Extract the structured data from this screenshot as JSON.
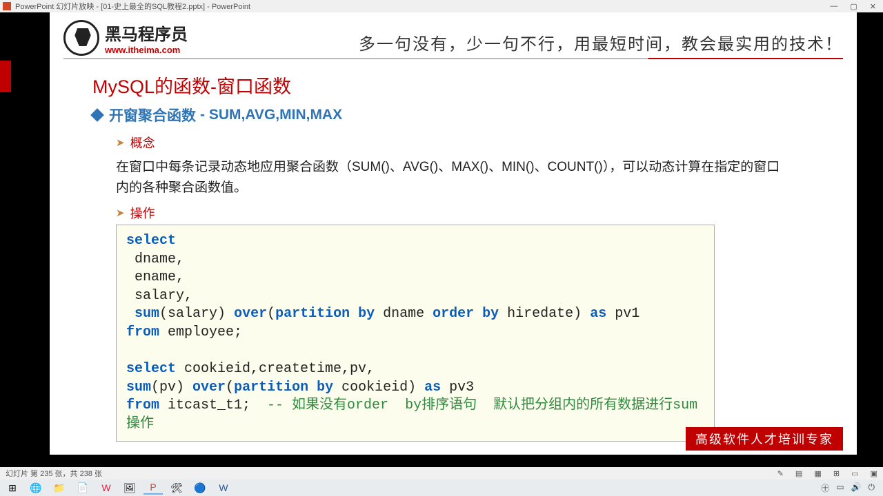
{
  "window": {
    "title": "PowerPoint 幻灯片放映 - [01-史上最全的SQL教程2.pptx] - PowerPoint",
    "min": "—",
    "restore": "▢",
    "close": "✕"
  },
  "logo": {
    "cn": "黑马程序员",
    "en": "www.itheima.com"
  },
  "slogan": "多一句没有，少一句不行，用最短时间，教会最实用的技术！",
  "slide_title": "MySQL的函数-窗口函数",
  "section": {
    "heading_main": "开窗聚合函数",
    "heading_suffix": "- SUM,AVG,MIN,MAX"
  },
  "sub": {
    "concept": "概念",
    "operation": "操作"
  },
  "body_text": "在窗口中每条记录动态地应用聚合函数（SUM()、AVG()、MAX()、MIN()、COUNT()），可以动态计算在指定的窗口内的各种聚合函数值。",
  "code": {
    "line1_kw": "select",
    "line2": " dname,",
    "line3": " ename,",
    "line4": " salary,",
    "line5_pre": " ",
    "line5_sum": "sum",
    "line5_mid1": "(salary) ",
    "line5_over": "over",
    "line5_mid2": "(",
    "line5_part": "partition by",
    "line5_mid3": " dname ",
    "line5_order": "order by",
    "line5_mid4": " hiredate) ",
    "line5_as": "as",
    "line5_end": " pv1",
    "line6_from": "from",
    "line6_end": " employee;",
    "line8_select": "select",
    "line8_end": " cookieid,createtime,pv,",
    "line9_sum": "sum",
    "line9_mid1": "(pv) ",
    "line9_over": "over",
    "line9_mid2": "(",
    "line9_part": "partition by",
    "line9_mid3": " cookieid) ",
    "line9_as": "as",
    "line9_end": " pv3",
    "line10_from": "from",
    "line10_mid": " itcast_t1;  ",
    "line10_comment": "-- 如果没有order  by排序语句  默认把分组内的所有数据进行sum操作"
  },
  "footer_badge": "高级软件人才培训专家",
  "status": {
    "left": "幻灯片 第 235 张，共 238 张"
  },
  "tray": {
    "t1": "㊉",
    "t2": "▭",
    "t3": "🔊",
    "t4": "⏻"
  }
}
